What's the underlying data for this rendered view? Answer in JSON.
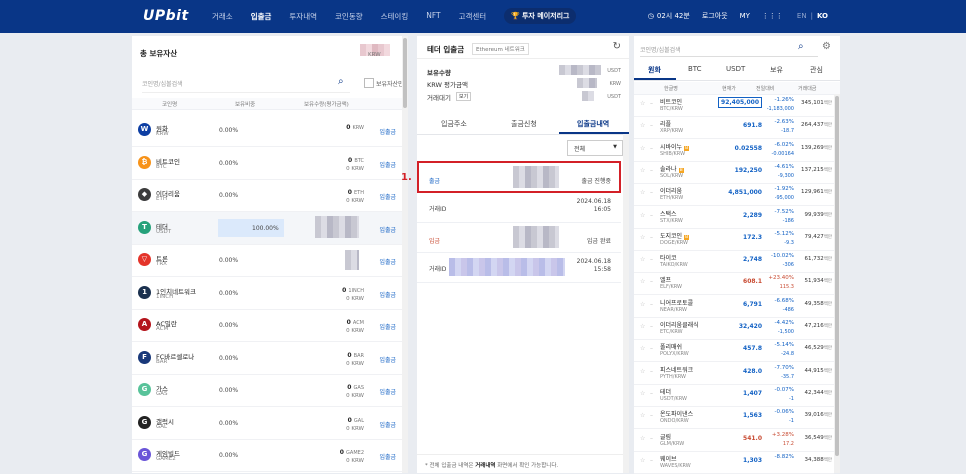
{
  "header": {
    "logo": "UPbit",
    "nav": [
      "거래소",
      "입출금",
      "투자내역",
      "코인동향",
      "스테이킹",
      "NFT",
      "고객센터"
    ],
    "nav_active_index": 1,
    "promo": "투자 메이저리그",
    "clock": "02시 42분",
    "logout": "로그아웃",
    "my": "MY",
    "lang_en": "EN",
    "lang_ko": "KO"
  },
  "assets": {
    "title": "총 보유자산",
    "unit": "KRW",
    "search_placeholder": "코인명/심볼검색",
    "held_only": "보유자산만",
    "columns": [
      "코인명",
      "보유비중",
      "보유수량(평가금액)"
    ],
    "rows": [
      {
        "icon": "w-icon",
        "color": "#0d3ea3",
        "glyph": "W",
        "name": "원화",
        "sym": "KRW",
        "pct": "0.00%",
        "amt": "0",
        "unit": "KRW",
        "sub": "",
        "action": "입출금"
      },
      {
        "icon": "bitcoin-icon",
        "color": "#f7931a",
        "glyph": "₿",
        "name": "비트코인",
        "sym": "BTC",
        "pct": "0.00%",
        "amt": "0",
        "unit": "BTC",
        "sub": "0 KRW",
        "action": "입출금"
      },
      {
        "icon": "ethereum-icon",
        "color": "#3c3c3d",
        "glyph": "◆",
        "name": "이더리움",
        "sym": "ETH",
        "pct": "0.00%",
        "amt": "0",
        "unit": "ETH",
        "sub": "0 KRW",
        "action": "입출금"
      },
      {
        "icon": "tether-icon",
        "color": "#26a17b",
        "glyph": "T",
        "name": "테더",
        "sym": "USDT",
        "pct": "100.00%",
        "amt": "",
        "unit": "",
        "sub": "",
        "action": "입출금"
      },
      {
        "icon": "tron-icon",
        "color": "#e4342a",
        "glyph": "▽",
        "name": "트론",
        "sym": "TRX",
        "pct": "0.00%",
        "amt": "",
        "unit": "",
        "sub": "",
        "action": "입출금"
      },
      {
        "icon": "1inch-icon",
        "color": "#1b314f",
        "glyph": "1",
        "name": "1인치네트워크",
        "sym": "1INCH",
        "pct": "0.00%",
        "amt": "0",
        "unit": "1INCH",
        "sub": "0 KRW",
        "action": "입출금"
      },
      {
        "icon": "acm-icon",
        "color": "#b4141c",
        "glyph": "A",
        "name": "AC밀란",
        "sym": "ACM",
        "pct": "0.00%",
        "amt": "0",
        "unit": "ACM",
        "sub": "0 KRW",
        "action": "입출금"
      },
      {
        "icon": "bar-icon",
        "color": "#19397a",
        "glyph": "F",
        "name": "FC바르셀로나",
        "sym": "BAR",
        "pct": "0.00%",
        "amt": "0",
        "unit": "BAR",
        "sub": "0 KRW",
        "action": "입출금"
      },
      {
        "icon": "gas-icon",
        "color": "#58c39a",
        "glyph": "G",
        "name": "가스",
        "sym": "GAS",
        "pct": "0.00%",
        "amt": "0",
        "unit": "GAS",
        "sub": "0 KRW",
        "action": "입출금"
      },
      {
        "icon": "gal-icon",
        "color": "#222222",
        "glyph": "G",
        "name": "갤럭시",
        "sym": "GAL",
        "pct": "0.00%",
        "amt": "0",
        "unit": "GAL",
        "sub": "0 KRW",
        "action": "입출금"
      },
      {
        "icon": "game2-icon",
        "color": "#6a55d8",
        "glyph": "G",
        "name": "게임빌드",
        "sym": "GAME2",
        "pct": "0.00%",
        "amt": "0",
        "unit": "GAME2",
        "sub": "0 KRW",
        "action": "입출금"
      }
    ]
  },
  "deposit": {
    "title": "테더 입출금",
    "network": "Ethereum 네트워크",
    "held_label": "보유수량",
    "krw_label": "KRW 평가금액",
    "pending_label": "거래대기",
    "pending_btn": "보기",
    "u1": "USDT",
    "u2": "KRW",
    "u3": "USDT",
    "tabs": [
      "입금주소",
      "출금신청",
      "입출금내역"
    ],
    "filter": "전체",
    "history": [
      {
        "type": "출금",
        "status": "출금 진행중",
        "id_label": "",
        "date": "",
        "time": ""
      },
      {
        "type": "",
        "status": "",
        "id_label": "거래ID",
        "date": "2024.06.18",
        "time": "16:05"
      },
      {
        "type": "입금",
        "status": "입금 완료",
        "id_label": "",
        "date": "",
        "time": ""
      },
      {
        "type": "",
        "status": "",
        "id_label": "거래ID",
        "date": "2024.06.18",
        "time": "15:58"
      }
    ],
    "annotation": "1.",
    "note_prefix": "* 전체 입출금 내역은 ",
    "note_link": "거래내역",
    "note_suffix": " 화면에서 확인 가능합니다."
  },
  "market": {
    "search_placeholder": "코인명/심볼검색",
    "tabs": [
      "원화",
      "BTC",
      "USDT",
      "보유",
      "관심"
    ],
    "columns": [
      "한글명",
      "현재가",
      "전일대비",
      "거래대금"
    ],
    "vol_unit": "백만",
    "rows": [
      {
        "name": "비트코인",
        "pair": "BTC/KRW",
        "price": "92,405,000",
        "ch": "-1.26%",
        "ch2": "-1,183,000",
        "vol": "345,101",
        "dir": "down",
        "badge": ""
      },
      {
        "name": "리플",
        "pair": "XRP/KRW",
        "price": "691.8",
        "ch": "-2.63%",
        "ch2": "-18.7",
        "vol": "264,437",
        "dir": "down",
        "badge": ""
      },
      {
        "name": "시바이누",
        "pair": "SHIB/KRW",
        "price": "0.02558",
        "ch": "-6.02%",
        "ch2": "-0.00164",
        "vol": "139,269",
        "dir": "down",
        "badge": "B"
      },
      {
        "name": "솔라나",
        "pair": "SOL/KRW",
        "price": "192,250",
        "ch": "-4.61%",
        "ch2": "-9,300",
        "vol": "137,215",
        "dir": "down",
        "badge": "B"
      },
      {
        "name": "이더리움",
        "pair": "ETH/KRW",
        "price": "4,851,000",
        "ch": "-1.92%",
        "ch2": "-95,000",
        "vol": "129,961",
        "dir": "down",
        "badge": ""
      },
      {
        "name": "스택스",
        "pair": "STX/KRW",
        "price": "2,289",
        "ch": "-7.52%",
        "ch2": "-186",
        "vol": "99,939",
        "dir": "down",
        "badge": ""
      },
      {
        "name": "도지코인",
        "pair": "DOGE/KRW",
        "price": "172.3",
        "ch": "-5.12%",
        "ch2": "-9.3",
        "vol": "79,427",
        "dir": "down",
        "badge": "B"
      },
      {
        "name": "타이코",
        "pair": "TAIKO/KRW",
        "price": "2,748",
        "ch": "-10.02%",
        "ch2": "-306",
        "vol": "61,732",
        "dir": "down",
        "badge": ""
      },
      {
        "name": "엘프",
        "pair": "ELF/KRW",
        "price": "608.1",
        "ch": "+23.40%",
        "ch2": "115.3",
        "vol": "51,934",
        "dir": "up",
        "badge": ""
      },
      {
        "name": "니어프로토콜",
        "pair": "NEAR/KRW",
        "price": "6,791",
        "ch": "-6.68%",
        "ch2": "-486",
        "vol": "49,358",
        "dir": "down",
        "badge": ""
      },
      {
        "name": "이더리움클래식",
        "pair": "ETC/KRW",
        "price": "32,420",
        "ch": "-4.42%",
        "ch2": "-1,500",
        "vol": "47,216",
        "dir": "down",
        "badge": ""
      },
      {
        "name": "폴리매쉬",
        "pair": "POLYX/KRW",
        "price": "457.8",
        "ch": "-5.14%",
        "ch2": "-24.8",
        "vol": "46,529",
        "dir": "down",
        "badge": ""
      },
      {
        "name": "피스네트워크",
        "pair": "PYTH/KRW",
        "price": "428.0",
        "ch": "-7.70%",
        "ch2": "-35.7",
        "vol": "44,915",
        "dir": "down",
        "badge": ""
      },
      {
        "name": "테더",
        "pair": "USDT/KRW",
        "price": "1,407",
        "ch": "-0.07%",
        "ch2": "-1",
        "vol": "42,344",
        "dir": "down",
        "badge": ""
      },
      {
        "name": "온도파이낸스",
        "pair": "ONDO/KRW",
        "price": "1,563",
        "ch": "-0.06%",
        "ch2": "-1",
        "vol": "39,016",
        "dir": "down",
        "badge": ""
      },
      {
        "name": "글림",
        "pair": "GLM/KRW",
        "price": "541.0",
        "ch": "+3.28%",
        "ch2": "17.2",
        "vol": "36,549",
        "dir": "up",
        "badge": ""
      },
      {
        "name": "웨이브",
        "pair": "WAVES/KRW",
        "price": "1,303",
        "ch": "-8.82%",
        "ch2": "",
        "vol": "34,388",
        "dir": "down",
        "badge": ""
      }
    ]
  }
}
